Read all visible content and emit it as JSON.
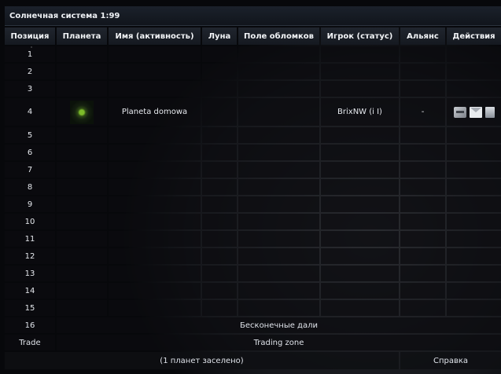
{
  "title": "Солнечная система 1:99",
  "headers": [
    "Позиция",
    "Планета",
    "Имя (активность)",
    "Луна",
    "Поле обломков",
    "Игрок (статус)",
    "Альянс",
    "Действия"
  ],
  "rows": [
    {
      "pos": "1"
    },
    {
      "pos": "2"
    },
    {
      "pos": "3"
    },
    {
      "pos": "4",
      "name": "Planeta domowa",
      "player": "BrixNW (i I)",
      "alliance": "-",
      "has_planet": true
    },
    {
      "pos": "5"
    },
    {
      "pos": "6"
    },
    {
      "pos": "7"
    },
    {
      "pos": "8"
    },
    {
      "pos": "9"
    },
    {
      "pos": "10"
    },
    {
      "pos": "11"
    },
    {
      "pos": "12"
    },
    {
      "pos": "13"
    },
    {
      "pos": "14"
    },
    {
      "pos": "15"
    }
  ],
  "row16": {
    "pos": "16",
    "label": "Бесконечные дали"
  },
  "trade": {
    "pos": "Trade",
    "label": "Trading zone"
  },
  "footer": {
    "summary": "(1 планет заселено)",
    "help": "Справка"
  },
  "actions_icons": [
    "spy-icon",
    "message-icon",
    "buddy-request-icon"
  ]
}
